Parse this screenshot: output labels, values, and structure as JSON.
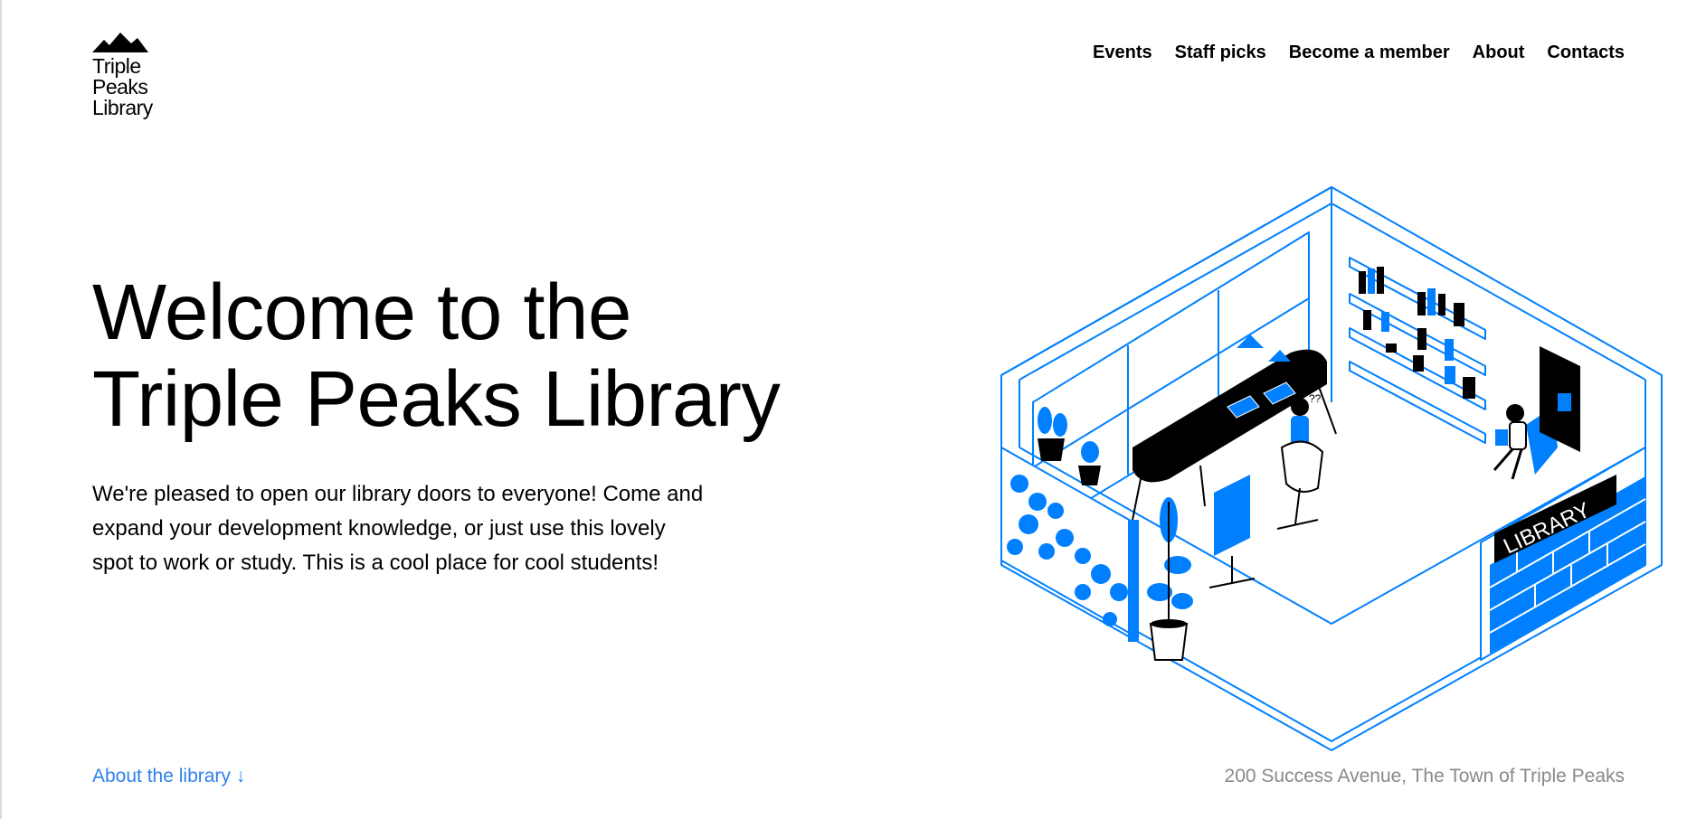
{
  "header": {
    "logo_lines": [
      "Triple",
      "Peaks",
      "Library"
    ],
    "nav": [
      {
        "label": "Events"
      },
      {
        "label": "Staff picks"
      },
      {
        "label": "Become a member"
      },
      {
        "label": "About"
      },
      {
        "label": "Contacts"
      }
    ]
  },
  "hero": {
    "title_lines": [
      "Welcome to the",
      "Triple Peaks Library"
    ],
    "description": "We're pleased to open our library doors to everyone! Come and expand your development knowledge, or just use this lovely spot to work or study. This is a cool place for cool students!",
    "illustration": {
      "icon": "isometric-library-room-illustration",
      "sign_text": "LIBRARY"
    }
  },
  "footer": {
    "about_link": "About the library ↓",
    "address": "200 Success Avenue, The Town of Triple Peaks"
  },
  "colors": {
    "accent": "#0080ff",
    "link": "#2f80ed",
    "muted": "#898989",
    "text": "#000000",
    "background": "#ffffff"
  }
}
